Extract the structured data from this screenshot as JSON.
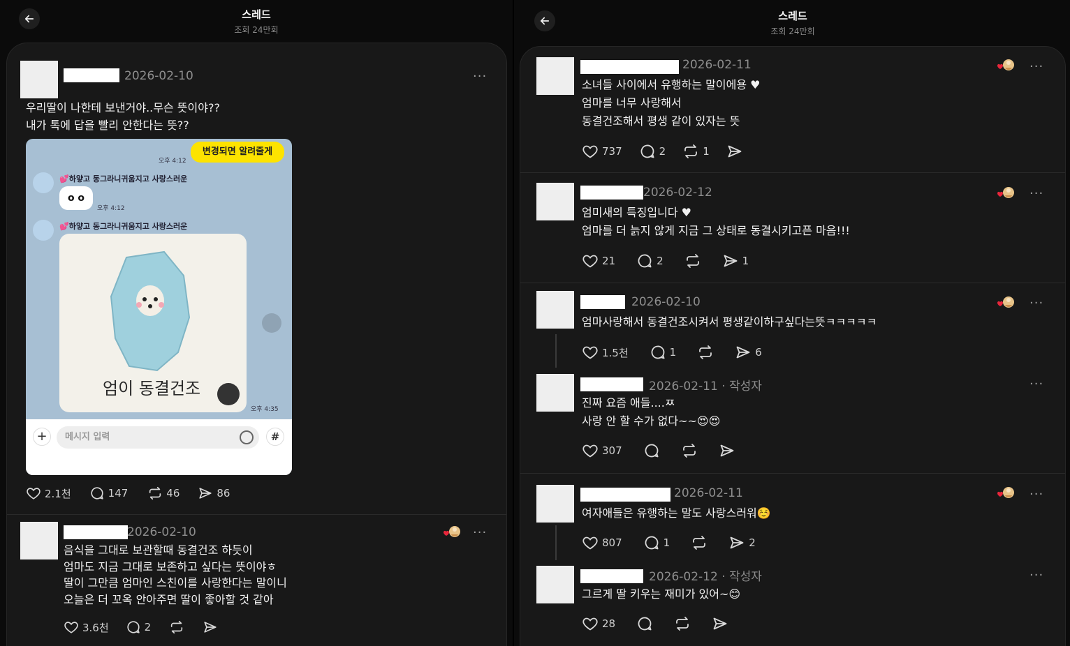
{
  "left": {
    "header": {
      "title": "스레드",
      "subtitle": "조회 24만회"
    },
    "main_post": {
      "date": "2026-02-10",
      "text_lines": [
        "우리딸이 나한테 보낸거야..무슨 뜻이야??",
        "내가 톡에 답을 빨리 안한다는 뜻??"
      ],
      "chat": {
        "yellow_bubble": "변경되면 알려줄게",
        "time1": "오후 4:12",
        "sender": "💕하얗고 동그라니귀움지고 사랑스러운",
        "bubble_text": "o o",
        "time2": "오후 4:12",
        "sticker_caption": "엄이 동결건조",
        "time3": "오후 4:35",
        "input_placeholder": "메시지 입력",
        "hash": "#",
        "plus": "+"
      },
      "likes": "2.1천",
      "comments": "147",
      "reposts": "46",
      "shares": "86"
    },
    "reply": {
      "date": "2026-02-10",
      "text_lines": [
        "음식을 그대로 보관할때 동결건조 하듯이",
        "엄마도 지금 그대로 보존하고 싶다는 뜻이야ㅎ",
        "딸이 그만큼 엄마인 스친이를 사랑한다는 말이니",
        "오늘은 더 꼬옥 안아주면 딸이 좋아할 것 같아"
      ],
      "likes": "3.6천",
      "comments": "2"
    }
  },
  "right": {
    "header": {
      "title": "스레드",
      "subtitle": "조회 24만회"
    },
    "posts": [
      {
        "date": "2026-02-11",
        "text_lines": [
          "소녀들 사이에서 유행하는 말이에용 ♥",
          "엄마를 너무 사랑해서",
          "동결건조해서 평생 같이 있자는 뜻"
        ],
        "likes": "737",
        "comments": "2",
        "reposts": "1"
      },
      {
        "date": "2026-02-12",
        "text_lines": [
          "엄미새의 특징입니다 ♥",
          "엄마를 더 늙지 않게 지금 그 상태로 동결시키고픈 마음!!!"
        ],
        "likes": "21",
        "comments": "2",
        "shares": "1"
      },
      {
        "date": "2026-02-10",
        "text_lines": [
          "엄마사랑해서 동결건조시켜서 평생같이하구싶다는뜻ㅋㅋㅋㅋㅋ"
        ],
        "likes": "1.5천",
        "comments": "1",
        "shares": "6"
      },
      {
        "date": "2026-02-11",
        "author_tag": "· 작성자",
        "text_lines": [
          "진짜 요즘 애들....ㅉ",
          "사랑 안 할 수가 없다~~😍😍"
        ],
        "likes": "307"
      },
      {
        "date": "2026-02-11",
        "text_lines": [
          "여자애들은 유행하는 말도 사랑스러워☺️"
        ],
        "likes": "807",
        "comments": "1",
        "shares": "2"
      },
      {
        "date": "2026-02-12",
        "author_tag": "· 작성자",
        "text_lines": [
          "그르게 딸 키우는 재미가 있어~😊"
        ],
        "likes": "28"
      }
    ]
  },
  "more_glyph": "···",
  "colors": {
    "background": "#000000",
    "card": "#181818",
    "text": "#f1f1f1",
    "muted": "#8e8e8e",
    "chat_bg": "#a7bfd3",
    "chat_yellow": "#fde300"
  }
}
